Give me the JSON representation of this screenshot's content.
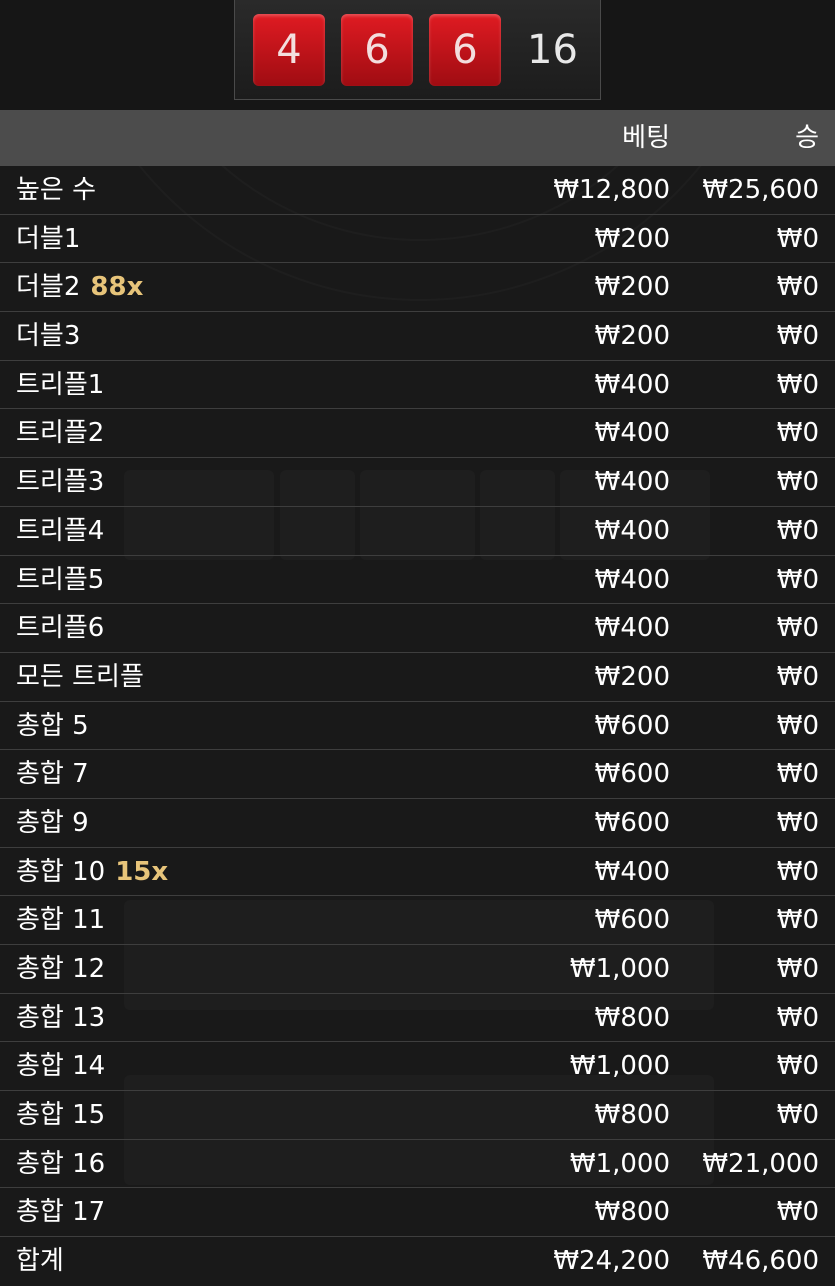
{
  "result": {
    "dice": [
      "4",
      "6",
      "6"
    ],
    "sum": "16"
  },
  "table": {
    "header_bet": "베팅",
    "header_win": "승",
    "rows": [
      {
        "label": "높은 수",
        "mult": "",
        "bet": "₩12,800",
        "win": "₩25,600"
      },
      {
        "label": "더블1",
        "mult": "",
        "bet": "₩200",
        "win": "₩0"
      },
      {
        "label": "더블2",
        "mult": "88x",
        "bet": "₩200",
        "win": "₩0"
      },
      {
        "label": "더블3",
        "mult": "",
        "bet": "₩200",
        "win": "₩0"
      },
      {
        "label": "트리플1",
        "mult": "",
        "bet": "₩400",
        "win": "₩0"
      },
      {
        "label": "트리플2",
        "mult": "",
        "bet": "₩400",
        "win": "₩0"
      },
      {
        "label": "트리플3",
        "mult": "",
        "bet": "₩400",
        "win": "₩0"
      },
      {
        "label": "트리플4",
        "mult": "",
        "bet": "₩400",
        "win": "₩0"
      },
      {
        "label": "트리플5",
        "mult": "",
        "bet": "₩400",
        "win": "₩0"
      },
      {
        "label": "트리플6",
        "mult": "",
        "bet": "₩400",
        "win": "₩0"
      },
      {
        "label": "모든 트리플",
        "mult": "",
        "bet": "₩200",
        "win": "₩0"
      },
      {
        "label": "총합 5",
        "mult": "",
        "bet": "₩600",
        "win": "₩0"
      },
      {
        "label": "총합 7",
        "mult": "",
        "bet": "₩600",
        "win": "₩0"
      },
      {
        "label": "총합 9",
        "mult": "",
        "bet": "₩600",
        "win": "₩0"
      },
      {
        "label": "총합 10",
        "mult": "15x",
        "bet": "₩400",
        "win": "₩0"
      },
      {
        "label": "총합 11",
        "mult": "",
        "bet": "₩600",
        "win": "₩0"
      },
      {
        "label": "총합 12",
        "mult": "",
        "bet": "₩1,000",
        "win": "₩0"
      },
      {
        "label": "총합 13",
        "mult": "",
        "bet": "₩800",
        "win": "₩0"
      },
      {
        "label": "총합 14",
        "mult": "",
        "bet": "₩1,000",
        "win": "₩0"
      },
      {
        "label": "총합 15",
        "mult": "",
        "bet": "₩800",
        "win": "₩0"
      },
      {
        "label": "총합 16",
        "mult": "",
        "bet": "₩1,000",
        "win": "₩21,000"
      },
      {
        "label": "총합 17",
        "mult": "",
        "bet": "₩800",
        "win": "₩0"
      }
    ],
    "total": {
      "label": "합계",
      "bet": "₩24,200",
      "win": "₩46,600"
    }
  },
  "colors": {
    "die_red": "#d3141b",
    "multiplier_gold": "#e7c47a",
    "header_bg": "#4c4c4c"
  }
}
